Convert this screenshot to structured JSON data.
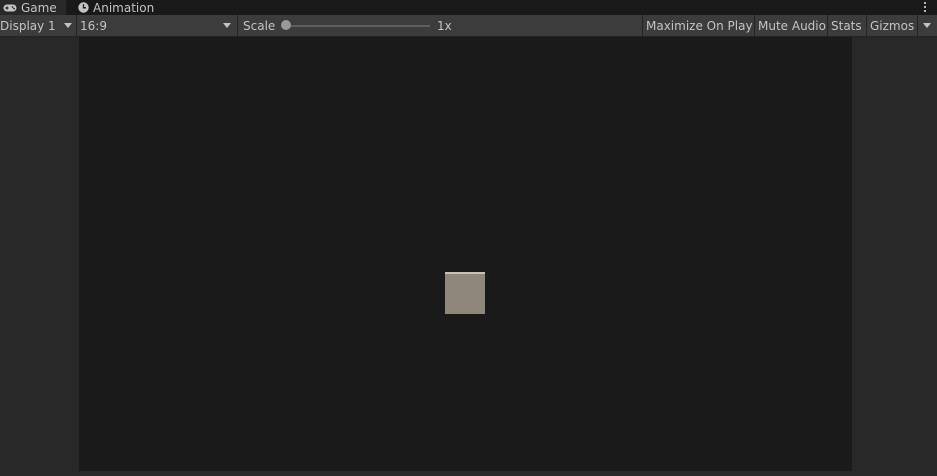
{
  "tabs": [
    {
      "label": "Game",
      "icon": "gamepad-icon",
      "active": true
    },
    {
      "label": "Animation",
      "icon": "clock-icon",
      "active": false
    }
  ],
  "toolbar": {
    "display_label": "Display 1",
    "aspect_label": "16:9",
    "scale_label": "Scale",
    "scale_value_label": "1x",
    "scale_fraction": 0.0,
    "maximize_label": "Maximize On Play",
    "mute_label": "Mute Audio",
    "stats_label": "Stats",
    "gizmos_label": "Gizmos"
  },
  "scene": {
    "background_color": "#1a1a1a",
    "object": "cube",
    "cube_face_color": "#8f877a",
    "cube_top_color": "#c7c0b3"
  }
}
